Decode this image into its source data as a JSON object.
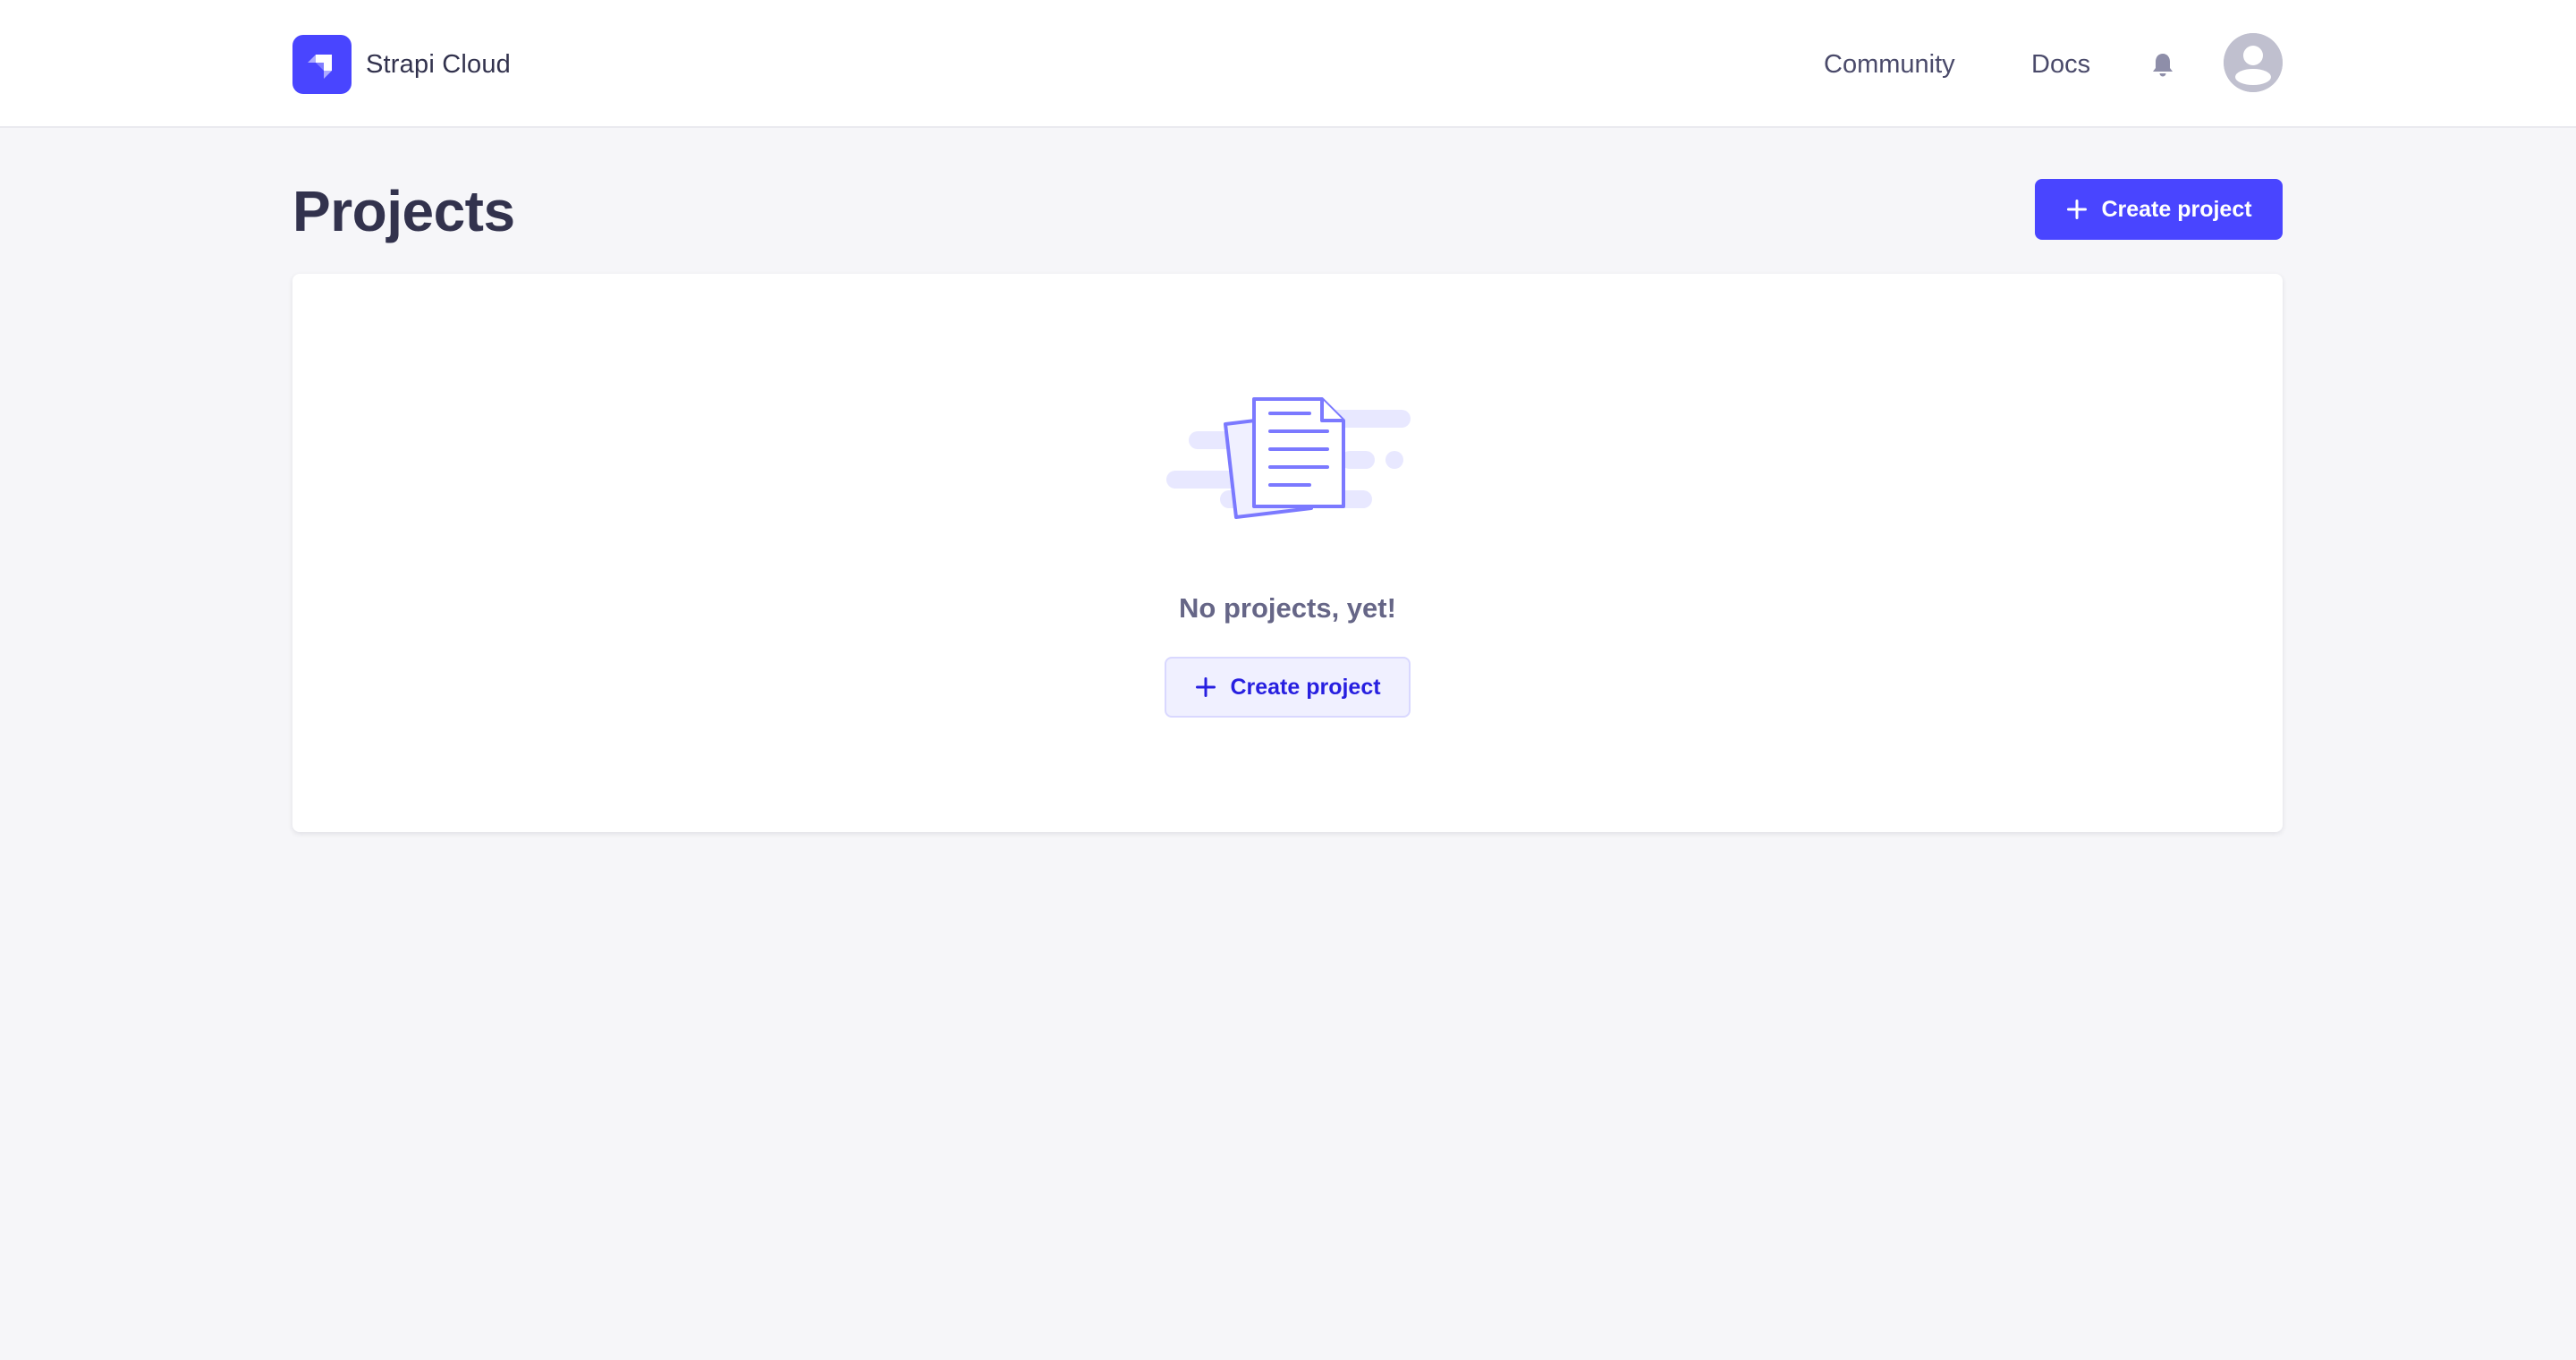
{
  "header": {
    "brand_name": "Strapi Cloud",
    "nav": {
      "community": "Community",
      "docs": "Docs"
    },
    "icons": [
      "strapi-logo",
      "bell-icon",
      "user-avatar-icon"
    ]
  },
  "main": {
    "title": "Projects",
    "create_button_label": "Create project",
    "empty_state": {
      "illustration": "documents-illustration",
      "message": "No projects, yet!",
      "button_label": "Create project"
    }
  },
  "colors": {
    "primary": "#4945ff",
    "background": "#f6f6f9",
    "text": "#32324d",
    "muted_text": "#666687",
    "secondary_button_bg": "#f0f0ff",
    "secondary_button_text": "#271fe0"
  }
}
